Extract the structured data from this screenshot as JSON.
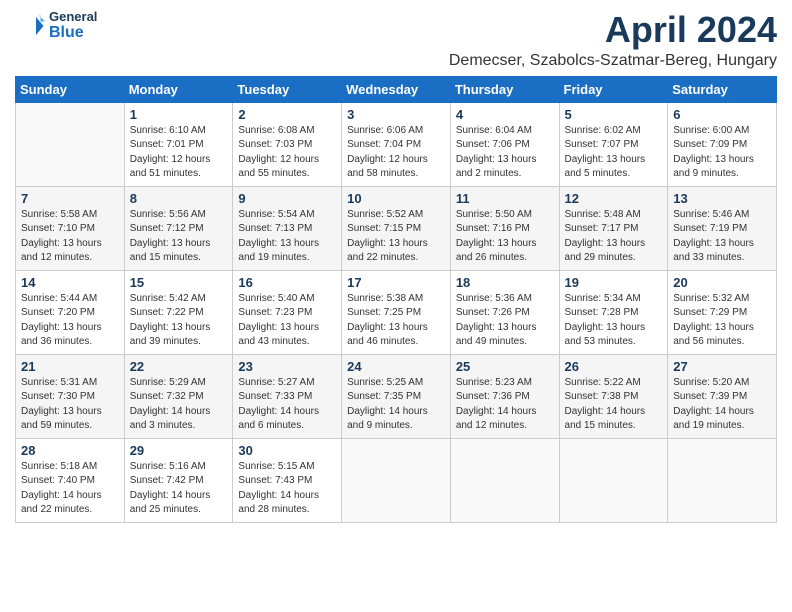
{
  "header": {
    "logo_general": "General",
    "logo_blue": "Blue",
    "month_title": "April 2024",
    "location": "Demecser, Szabolcs-Szatmar-Bereg, Hungary"
  },
  "days_of_week": [
    "Sunday",
    "Monday",
    "Tuesday",
    "Wednesday",
    "Thursday",
    "Friday",
    "Saturday"
  ],
  "weeks": [
    [
      {
        "day": "",
        "info": ""
      },
      {
        "day": "1",
        "info": "Sunrise: 6:10 AM\nSunset: 7:01 PM\nDaylight: 12 hours\nand 51 minutes."
      },
      {
        "day": "2",
        "info": "Sunrise: 6:08 AM\nSunset: 7:03 PM\nDaylight: 12 hours\nand 55 minutes."
      },
      {
        "day": "3",
        "info": "Sunrise: 6:06 AM\nSunset: 7:04 PM\nDaylight: 12 hours\nand 58 minutes."
      },
      {
        "day": "4",
        "info": "Sunrise: 6:04 AM\nSunset: 7:06 PM\nDaylight: 13 hours\nand 2 minutes."
      },
      {
        "day": "5",
        "info": "Sunrise: 6:02 AM\nSunset: 7:07 PM\nDaylight: 13 hours\nand 5 minutes."
      },
      {
        "day": "6",
        "info": "Sunrise: 6:00 AM\nSunset: 7:09 PM\nDaylight: 13 hours\nand 9 minutes."
      }
    ],
    [
      {
        "day": "7",
        "info": "Sunrise: 5:58 AM\nSunset: 7:10 PM\nDaylight: 13 hours\nand 12 minutes."
      },
      {
        "day": "8",
        "info": "Sunrise: 5:56 AM\nSunset: 7:12 PM\nDaylight: 13 hours\nand 15 minutes."
      },
      {
        "day": "9",
        "info": "Sunrise: 5:54 AM\nSunset: 7:13 PM\nDaylight: 13 hours\nand 19 minutes."
      },
      {
        "day": "10",
        "info": "Sunrise: 5:52 AM\nSunset: 7:15 PM\nDaylight: 13 hours\nand 22 minutes."
      },
      {
        "day": "11",
        "info": "Sunrise: 5:50 AM\nSunset: 7:16 PM\nDaylight: 13 hours\nand 26 minutes."
      },
      {
        "day": "12",
        "info": "Sunrise: 5:48 AM\nSunset: 7:17 PM\nDaylight: 13 hours\nand 29 minutes."
      },
      {
        "day": "13",
        "info": "Sunrise: 5:46 AM\nSunset: 7:19 PM\nDaylight: 13 hours\nand 33 minutes."
      }
    ],
    [
      {
        "day": "14",
        "info": "Sunrise: 5:44 AM\nSunset: 7:20 PM\nDaylight: 13 hours\nand 36 minutes."
      },
      {
        "day": "15",
        "info": "Sunrise: 5:42 AM\nSunset: 7:22 PM\nDaylight: 13 hours\nand 39 minutes."
      },
      {
        "day": "16",
        "info": "Sunrise: 5:40 AM\nSunset: 7:23 PM\nDaylight: 13 hours\nand 43 minutes."
      },
      {
        "day": "17",
        "info": "Sunrise: 5:38 AM\nSunset: 7:25 PM\nDaylight: 13 hours\nand 46 minutes."
      },
      {
        "day": "18",
        "info": "Sunrise: 5:36 AM\nSunset: 7:26 PM\nDaylight: 13 hours\nand 49 minutes."
      },
      {
        "day": "19",
        "info": "Sunrise: 5:34 AM\nSunset: 7:28 PM\nDaylight: 13 hours\nand 53 minutes."
      },
      {
        "day": "20",
        "info": "Sunrise: 5:32 AM\nSunset: 7:29 PM\nDaylight: 13 hours\nand 56 minutes."
      }
    ],
    [
      {
        "day": "21",
        "info": "Sunrise: 5:31 AM\nSunset: 7:30 PM\nDaylight: 13 hours\nand 59 minutes."
      },
      {
        "day": "22",
        "info": "Sunrise: 5:29 AM\nSunset: 7:32 PM\nDaylight: 14 hours\nand 3 minutes."
      },
      {
        "day": "23",
        "info": "Sunrise: 5:27 AM\nSunset: 7:33 PM\nDaylight: 14 hours\nand 6 minutes."
      },
      {
        "day": "24",
        "info": "Sunrise: 5:25 AM\nSunset: 7:35 PM\nDaylight: 14 hours\nand 9 minutes."
      },
      {
        "day": "25",
        "info": "Sunrise: 5:23 AM\nSunset: 7:36 PM\nDaylight: 14 hours\nand 12 minutes."
      },
      {
        "day": "26",
        "info": "Sunrise: 5:22 AM\nSunset: 7:38 PM\nDaylight: 14 hours\nand 15 minutes."
      },
      {
        "day": "27",
        "info": "Sunrise: 5:20 AM\nSunset: 7:39 PM\nDaylight: 14 hours\nand 19 minutes."
      }
    ],
    [
      {
        "day": "28",
        "info": "Sunrise: 5:18 AM\nSunset: 7:40 PM\nDaylight: 14 hours\nand 22 minutes."
      },
      {
        "day": "29",
        "info": "Sunrise: 5:16 AM\nSunset: 7:42 PM\nDaylight: 14 hours\nand 25 minutes."
      },
      {
        "day": "30",
        "info": "Sunrise: 5:15 AM\nSunset: 7:43 PM\nDaylight: 14 hours\nand 28 minutes."
      },
      {
        "day": "",
        "info": ""
      },
      {
        "day": "",
        "info": ""
      },
      {
        "day": "",
        "info": ""
      },
      {
        "day": "",
        "info": ""
      }
    ]
  ]
}
